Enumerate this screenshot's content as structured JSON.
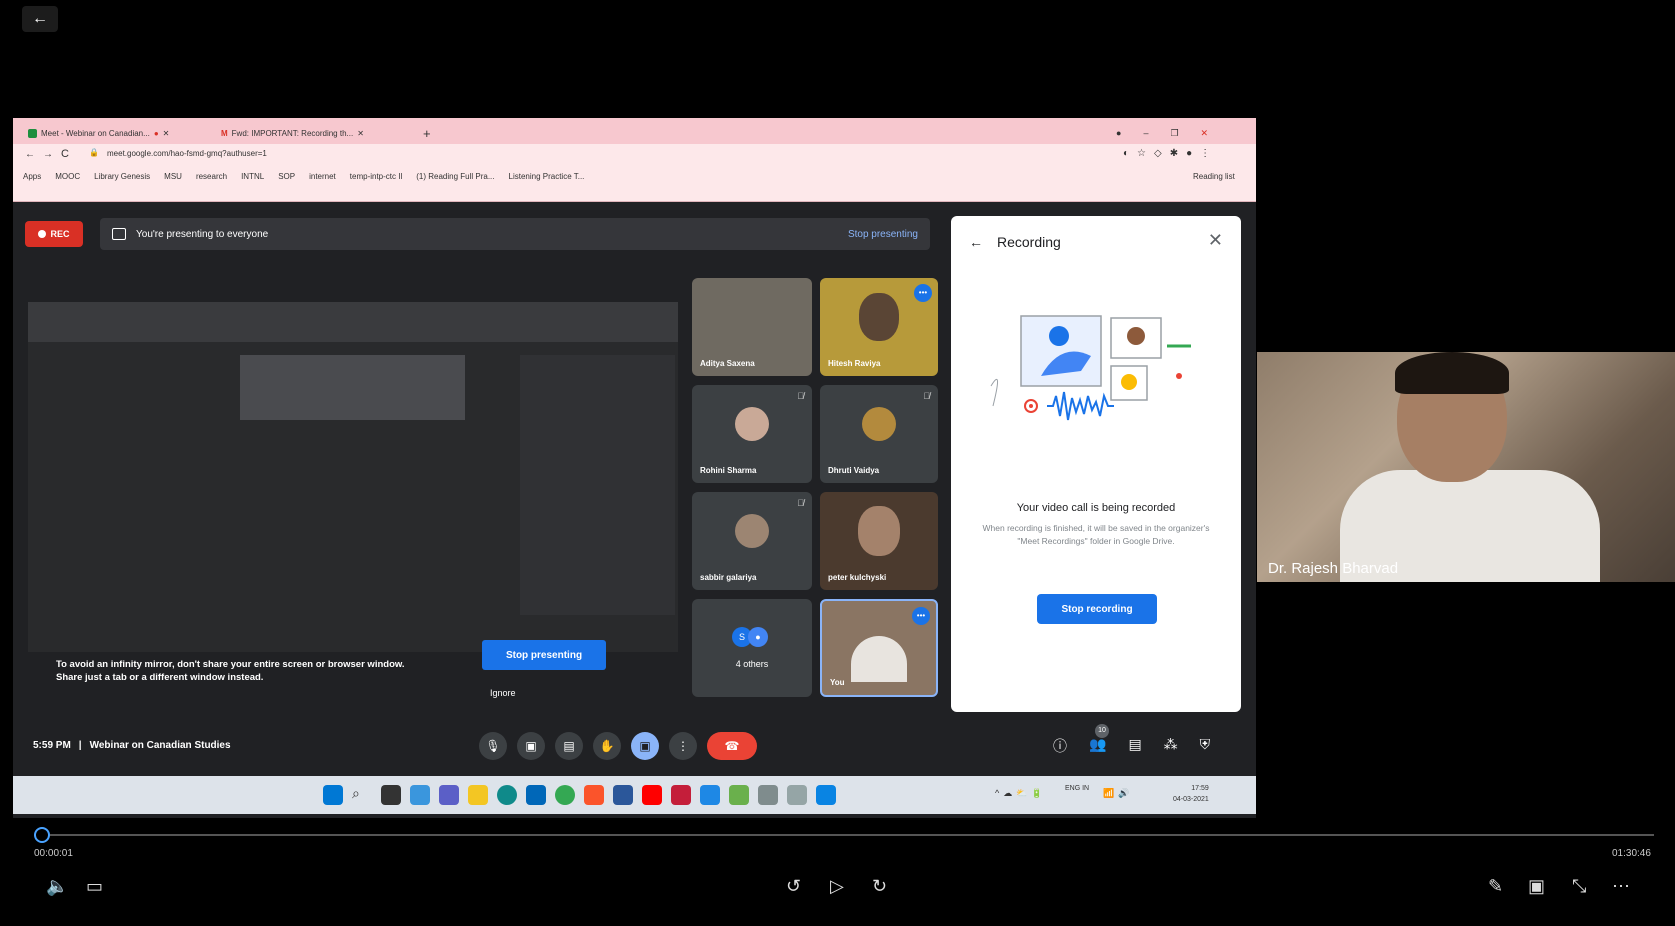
{
  "player": {
    "elapsed": "00:00:01",
    "duration": "01:30:46",
    "progress": 0.0
  },
  "browser": {
    "tabs": [
      {
        "label": "Meet - Webinar on Canadian..."
      },
      {
        "label": "Fwd: IMPORTANT: Recording th..."
      }
    ],
    "url": "meet.google.com/hao-fsmd-gmq?authuser=1",
    "bookmarks": [
      "Apps",
      "MOOC",
      "Library Genesis",
      "MSU",
      "research",
      "INTNL",
      "SOP",
      "internet",
      "temp-intp-ctc Il",
      "(1) Reading Full Pra...",
      "Listening Practice T..."
    ],
    "reading_list": "Reading list"
  },
  "meet": {
    "rec_label": "REC",
    "presenting_text": "You're presenting to everyone",
    "stop_presenting_top": "Stop presenting",
    "infinity_warning": "To avoid an infinity mirror, don't share your entire screen or browser window. Share just a tab or a different window instead.",
    "stop_presenting_button": "Stop presenting",
    "ignore": "Ignore",
    "time": "5:59 PM",
    "separator": "|",
    "meeting_name": "Webinar on Canadian Studies",
    "participants_count": "10",
    "tiles": [
      {
        "name": "Aditya Saxena"
      },
      {
        "name": "Hitesh Raviya"
      },
      {
        "name": "Rohini Sharma"
      },
      {
        "name": "Dhruti Vaidya"
      },
      {
        "name": "sabbir galariya"
      },
      {
        "name": "peter kulchyski"
      },
      {
        "name": "4 others"
      },
      {
        "name": "You"
      }
    ]
  },
  "recording_panel": {
    "title": "Recording",
    "message": "Your video call is being recorded",
    "sub": "When recording is finished, it will be saved in the organizer's \"Meet Recordings\" folder in Google Drive.",
    "button": "Stop recording"
  },
  "taskbar": {
    "clock_time": "17:59",
    "clock_date": "04-03-2021",
    "lang": "ENG IN"
  },
  "webcam": {
    "name": "Dr. Rajesh Bharvad"
  },
  "colors": {
    "rec_red": "#d93025",
    "meet_blue": "#1a73e8",
    "meet_bg": "#202124",
    "hang_red": "#ea4335"
  }
}
